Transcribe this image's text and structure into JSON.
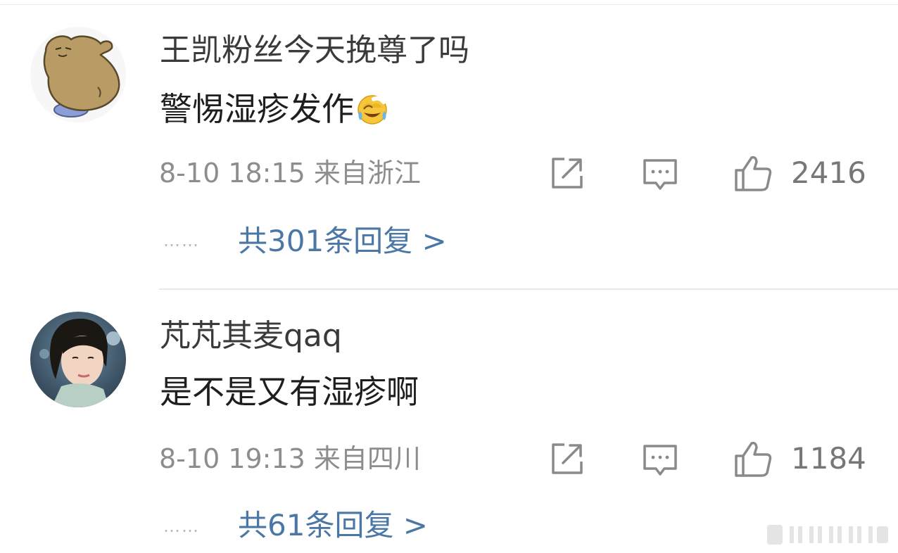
{
  "comments": [
    {
      "username": "王凯粉丝今天挽尊了吗",
      "text": "警惕湿疹发作",
      "emoji": "laughing-crying-emoji",
      "meta": "8-10 18:15 来自浙江",
      "likes": "2416",
      "replies": "共301条回复 >",
      "dots": "……"
    },
    {
      "username": "芃芃其麦qaq",
      "text": "是不是又有湿疹啊",
      "meta": "8-10 19:13 来自四川",
      "likes": "1184",
      "replies": "共61条回复 >",
      "dots": "……"
    }
  ],
  "icons": [
    "share-icon",
    "comment-icon",
    "like-icon"
  ],
  "colors": {
    "reply_link": "#4b77a7",
    "meta": "#8d8d8d",
    "icon": "#8a8a8a"
  }
}
